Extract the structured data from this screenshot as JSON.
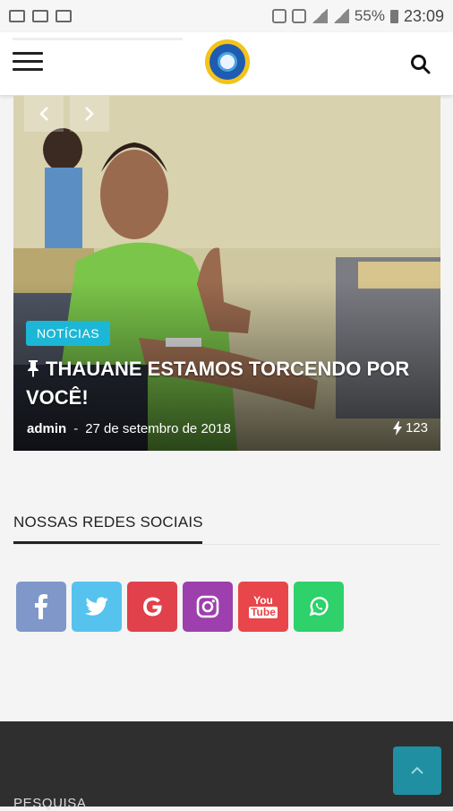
{
  "statusbar": {
    "battery": "55%",
    "time": "23:09"
  },
  "header": {
    "menu_icon": "hamburger-icon",
    "logo": "organization-logo",
    "search_icon": "search-icon"
  },
  "hero": {
    "category": "NOTÍCIAS",
    "title": "THAUANE ESTAMOS TORCENDO POR VOCÊ!",
    "author": "admin",
    "separator": "-",
    "date": "27 de setembro de 2018",
    "views": "123",
    "prev_icon": "chevron-left-icon",
    "next_icon": "chevron-right-icon",
    "pin_icon": "pin-icon",
    "bolt_icon": "bolt-icon"
  },
  "social": {
    "title": "NOSSAS REDES SOCIAIS",
    "buttons": [
      {
        "name": "facebook",
        "icon": "facebook-icon",
        "color": "#7f97c9"
      },
      {
        "name": "twitter",
        "icon": "twitter-icon",
        "color": "#55c3ee"
      },
      {
        "name": "google",
        "icon": "google-icon",
        "color": "#e0414b"
      },
      {
        "name": "instagram",
        "icon": "instagram-icon",
        "color": "#9d3fad"
      },
      {
        "name": "youtube",
        "icon": "youtube-icon",
        "color": "#e8464a"
      },
      {
        "name": "whatsapp",
        "icon": "whatsapp-icon",
        "color": "#2ed16a"
      }
    ],
    "youtube_text_top": "You",
    "youtube_text_bottom": "Tube"
  },
  "footer": {
    "title": "PESQUISA",
    "back_to_top_icon": "chevron-up-icon"
  },
  "colors": {
    "accent": "#1cb7d6",
    "footer_bg": "#2f2f2f",
    "back_to_top": "#1f8fa1"
  }
}
